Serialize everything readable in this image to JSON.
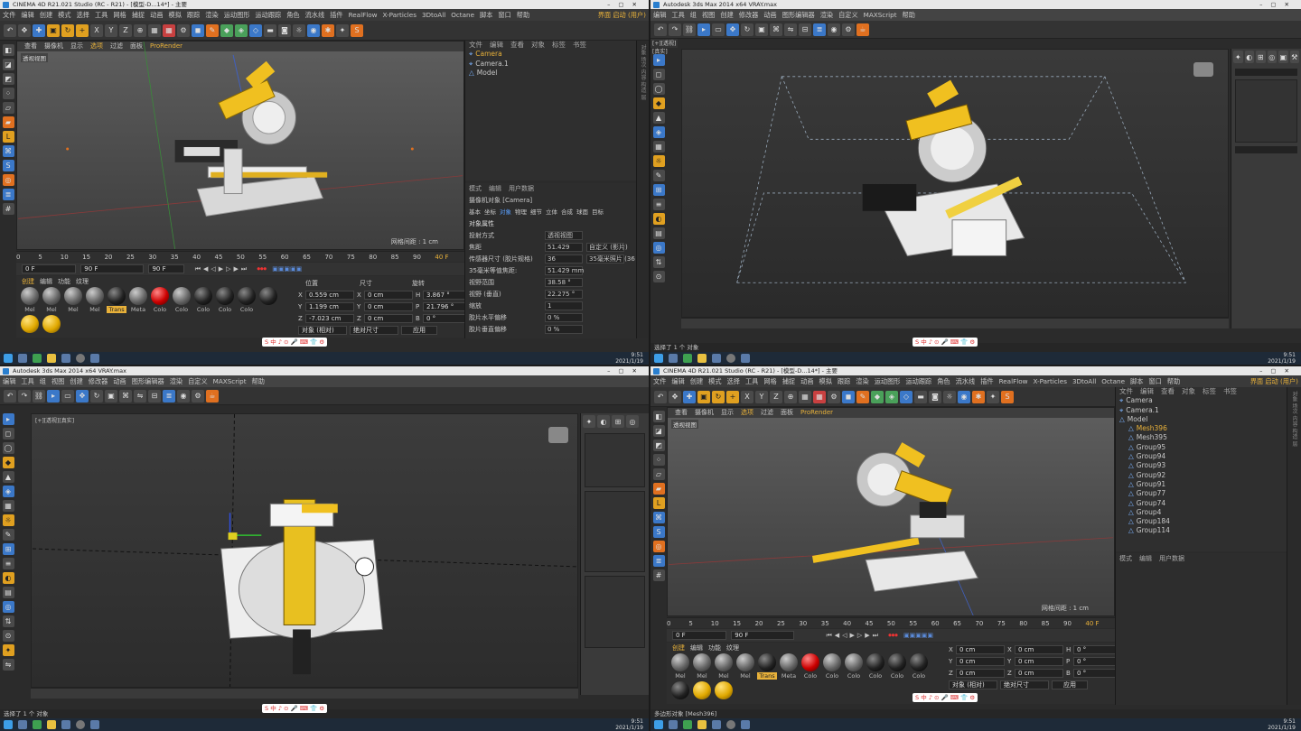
{
  "q1": {
    "title": "CINEMA 4D R21.021 Studio (RC - R21) - [模型-D...14*] - 主要",
    "menu": [
      "文件",
      "编辑",
      "创建",
      "模式",
      "选择",
      "工具",
      "网格",
      "捕捉",
      "动画",
      "模拟",
      "跟踪",
      "渲染",
      "运动图形",
      "运动跟踪",
      "角色",
      "流水线",
      "插件",
      "RealFlow",
      "X-Particles",
      "3DtoAll",
      "Octane",
      "脚本",
      "窗口",
      "帮助"
    ],
    "menu_right": "界面  启动 (用户)",
    "viewport_menu": [
      "查看",
      "摄像机",
      "显示",
      "选项",
      "过滤",
      "面板"
    ],
    "viewport_render": "ProRender",
    "viewport_label": "透视视图",
    "grid_note": "网格间距 : 1 cm",
    "timeline_ticks": [
      "0",
      "5",
      "10",
      "15",
      "20",
      "25",
      "30",
      "35",
      "40",
      "45",
      "50",
      "55",
      "60",
      "65",
      "70",
      "75",
      "80",
      "85",
      "90"
    ],
    "frame_current": "40 F",
    "frame_start": "0 F",
    "frame_end": "90 F",
    "frame_end2": "90 F",
    "mat_tabs": [
      "创建",
      "编辑",
      "功能",
      "纹理"
    ],
    "materials": [
      {
        "name": "Mel",
        "k": "gy"
      },
      {
        "name": "Mel",
        "k": "gy"
      },
      {
        "name": "Mel",
        "k": "gy"
      },
      {
        "name": "Mel",
        "k": "gy"
      },
      {
        "name": "Trans",
        "k": "dk",
        "sel": true
      },
      {
        "name": "Meta",
        "k": "gy"
      },
      {
        "name": "Colo",
        "k": "rd"
      },
      {
        "name": "Colo",
        "k": "gy"
      },
      {
        "name": "Colo",
        "k": "dk"
      },
      {
        "name": "Colo",
        "k": "dk"
      },
      {
        "name": "Colo",
        "k": "dk"
      },
      {
        "name": "",
        "k": "dk"
      },
      {
        "name": "",
        "k": "yl"
      },
      {
        "name": "",
        "k": "yl"
      }
    ],
    "coords_head": [
      "位置",
      "尺寸",
      "旋转"
    ],
    "coords": [
      {
        "a": "X",
        "p": "0.559 cm",
        "s": "X",
        "sv": "0 cm",
        "r": "H",
        "rv": "3.867 °"
      },
      {
        "a": "Y",
        "p": "1.199 cm",
        "s": "Y",
        "sv": "0 cm",
        "r": "P",
        "rv": "21.796 °"
      },
      {
        "a": "Z",
        "p": "-7.023 cm",
        "s": "Z",
        "sv": "0 cm",
        "r": "B",
        "rv": "0 °"
      }
    ],
    "coords_btns": [
      "对象 (相对)",
      "绝对尺寸",
      "应用"
    ],
    "objects": [
      {
        "name": "Camera",
        "sel": true
      },
      {
        "name": "Camera.1"
      },
      {
        "name": "Model"
      }
    ],
    "obj_menu": [
      "文件",
      "编辑",
      "查看",
      "对象",
      "标签",
      "书签"
    ],
    "attr_menu": [
      "模式",
      "编辑",
      "用户数据"
    ],
    "attr_title": "摄像机对象 [Camera]",
    "attr_tabs": [
      "基本",
      "坐标",
      "对象",
      "物理",
      "细节",
      "立体",
      "合成",
      "球面",
      "目标"
    ],
    "attr_section": "对象属性",
    "attr_rows": [
      {
        "n": "投射方式",
        "v": "透视视图"
      },
      {
        "n": "焦距",
        "v": "51.429",
        "v2": "自定义 (影片)"
      },
      {
        "n": "传感器尺寸 (胶片规格)",
        "v": "36",
        "v2": "35毫米照片 (36"
      },
      {
        "n": "35毫米等值焦距:",
        "v": "51.429 mm"
      },
      {
        "n": "视野范围",
        "v": "38.58 °"
      },
      {
        "n": "视野 (垂直)",
        "v": "22.275 °"
      },
      {
        "n": "缩放",
        "v": "1"
      },
      {
        "n": "胶片水平偏移",
        "v": "0 %"
      },
      {
        "n": "胶片垂直偏移",
        "v": "0 %"
      }
    ],
    "clock_time": "9:51",
    "clock_date": "2021/1/19",
    "ime": "S 中 ♪ ⊙ 🎤 ⌨ 👕 ⚙"
  },
  "q2": {
    "title": "Autodesk 3ds Max 2014 x64    VRAY.max",
    "menu": [
      "编辑",
      "工具",
      "组",
      "视图",
      "创建",
      "修改器",
      "动画",
      "图形编辑器",
      "渲染",
      "自定义",
      "MAXScript",
      "帮助"
    ],
    "viewport_label": "[+][透视][真实]",
    "status": "选择了 1 个 对象",
    "clock_time": "9:51",
    "clock_date": "2021/1/19",
    "ime": "S 中 ♪ ⊙ 🎤 ⌨ 👕 ⚙"
  },
  "q3": {
    "title": "Autodesk 3ds Max 2014 x64    VRAY.max",
    "menu": [
      "编辑",
      "工具",
      "组",
      "视图",
      "创建",
      "修改器",
      "动画",
      "图形编辑器",
      "渲染",
      "自定义",
      "MAXScript",
      "帮助"
    ],
    "viewport_label": "[+][透视][真实]",
    "status": "选择了 1 个 对象",
    "clock_time": "9:51",
    "clock_date": "2021/1/19",
    "ime": "S 中 ♪ ⊙ 🎤 ⌨ 👕 ⚙"
  },
  "q4": {
    "title": "CINEMA 4D R21.021 Studio (RC - R21) - [模型-D...14*] - 主要",
    "menu": [
      "文件",
      "编辑",
      "创建",
      "模式",
      "选择",
      "工具",
      "网格",
      "捕捉",
      "动画",
      "模拟",
      "跟踪",
      "渲染",
      "运动图形",
      "运动跟踪",
      "角色",
      "流水线",
      "插件",
      "RealFlow",
      "X-Particles",
      "3DtoAll",
      "Octane",
      "脚本",
      "窗口",
      "帮助"
    ],
    "menu_right": "界面  启动 (用户)",
    "viewport_menu": [
      "查看",
      "摄像机",
      "显示",
      "选项",
      "过滤",
      "面板"
    ],
    "viewport_render": "ProRender",
    "viewport_label": "透视视图",
    "grid_note": "网格间距 : 1 cm",
    "timeline_ticks": [
      "0",
      "5",
      "10",
      "15",
      "20",
      "25",
      "30",
      "35",
      "40",
      "45",
      "50",
      "55",
      "60",
      "65",
      "70",
      "75",
      "80",
      "85",
      "90"
    ],
    "frame_current": "40 F",
    "frame_start": "0 F",
    "frame_end": "90 F",
    "mat_tabs": [
      "创建",
      "编辑",
      "功能",
      "纹理"
    ],
    "materials": [
      {
        "name": "Mel",
        "k": "gy"
      },
      {
        "name": "Mel",
        "k": "gy"
      },
      {
        "name": "Mel",
        "k": "gy"
      },
      {
        "name": "Mel",
        "k": "gy"
      },
      {
        "name": "Trans",
        "k": "dk",
        "sel": true
      },
      {
        "name": "Meta",
        "k": "gy"
      },
      {
        "name": "Colo",
        "k": "rd"
      },
      {
        "name": "Colo",
        "k": "gy"
      },
      {
        "name": "Colo",
        "k": "gy"
      },
      {
        "name": "Colo",
        "k": "dk"
      },
      {
        "name": "Colo",
        "k": "dk"
      },
      {
        "name": "Colo",
        "k": "dk"
      },
      {
        "name": "",
        "k": "dk"
      },
      {
        "name": "",
        "k": "yl"
      },
      {
        "name": "",
        "k": "yl"
      }
    ],
    "coords": [
      {
        "a": "X",
        "p": "0 cm",
        "s": "X",
        "sv": "0 cm",
        "r": "H",
        "rv": "0 °"
      },
      {
        "a": "Y",
        "p": "0 cm",
        "s": "Y",
        "sv": "0 cm",
        "r": "P",
        "rv": "0 °"
      },
      {
        "a": "Z",
        "p": "0 cm",
        "s": "Z",
        "sv": "0 cm",
        "r": "B",
        "rv": "0 °"
      }
    ],
    "coords_btns": [
      "对象 (相对)",
      "绝对尺寸",
      "应用"
    ],
    "objects": [
      {
        "name": "Camera"
      },
      {
        "name": "Camera.1"
      },
      {
        "name": "Model"
      },
      {
        "name": "Mesh396",
        "sel": true
      },
      {
        "name": "Mesh395"
      },
      {
        "name": "Group95"
      },
      {
        "name": "Group94"
      },
      {
        "name": "Group93"
      },
      {
        "name": "Group92"
      },
      {
        "name": "Group91"
      },
      {
        "name": "Group77"
      },
      {
        "name": "Group74"
      },
      {
        "name": "Group4"
      },
      {
        "name": "Group184"
      },
      {
        "name": "Group114"
      }
    ],
    "obj_menu": [
      "文件",
      "编辑",
      "查看",
      "对象",
      "标签",
      "书签"
    ],
    "attr_menu": [
      "模式",
      "编辑",
      "用户数据"
    ],
    "status": "多边形对象 [Mesh396]",
    "clock_time": "9:51",
    "clock_date": "2021/1/19",
    "ime": "S 中 ♪ ⊙ 🎤 ⌨ 👕 ⚙"
  }
}
